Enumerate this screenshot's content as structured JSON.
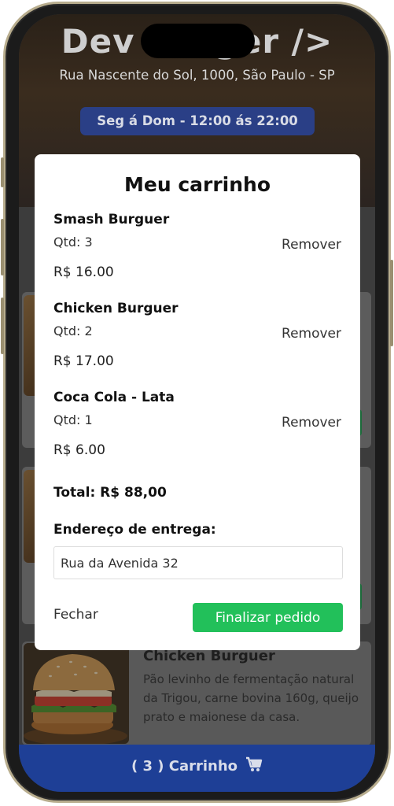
{
  "header": {
    "title": "Dev Burger />",
    "address": "Rua Nascente do Sol, 1000, São Paulo - SP",
    "hours": "Seg á Dom - 12:00 ás 22:00"
  },
  "background_card": {
    "title": "Chicken Burguer",
    "description": "Pão levinho de fermentação natural da Trigou, carne bovina 160g, queijo prato e maionese da casa."
  },
  "cart_bar": {
    "label": "( 3 ) Carrinho",
    "icon": "cart-icon"
  },
  "modal": {
    "title": "Meu carrinho",
    "items": [
      {
        "name": "Smash Burguer",
        "qty": "Qtd: 3",
        "price": "R$ 16.00",
        "remove": "Remover"
      },
      {
        "name": "Chicken Burguer",
        "qty": "Qtd: 2",
        "price": "R$ 17.00",
        "remove": "Remover"
      },
      {
        "name": "Coca Cola - Lata",
        "qty": "Qtd: 1",
        "price": "R$ 6.00",
        "remove": "Remover"
      }
    ],
    "total": "Total: R$ 88,00",
    "address_label": "Endereço de entrega:",
    "address_value": "Rua da Avenida 32",
    "close_label": "Fechar",
    "finish_label": "Finalizar pedido"
  },
  "colors": {
    "accent_blue": "#1e3f96",
    "finish_green": "#22c05a"
  }
}
